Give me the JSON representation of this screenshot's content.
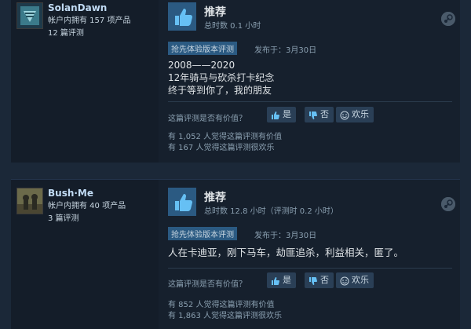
{
  "reviews": [
    {
      "username": "SolanDawn",
      "products_owned": "帐户内拥有 157 项产品",
      "reviews_count": "12 篇评测",
      "recommendation": "推荐",
      "hours": "总时数 0.1 小时",
      "early_access_badge": "抢先体验版本评测",
      "posted": "发布于：3月30日",
      "text_lines": [
        "2008——2020",
        "12年骑马与砍杀打卡纪念",
        "终于等到你了，我的朋友"
      ],
      "helpful_question": "这篇评测是否有价值？",
      "vote_yes": "是",
      "vote_no": "否",
      "vote_funny": "欢乐",
      "helpful_count": "有 1,052 人觉得这篇评测有价值",
      "funny_count": "有 167 人觉得这篇评测很欢乐"
    },
    {
      "username": "Bush·Me",
      "products_owned": "帐户内拥有 40 项产品",
      "reviews_count": "3 篇评测",
      "recommendation": "推荐",
      "hours": "总时数 12.8 小时（评测时 0.2 小时）",
      "early_access_badge": "抢先体验版本评测",
      "posted": "发布于：3月30日",
      "text_lines": [
        "人在卡迪亚，刚下马车，劫匪追杀，利益相关，匿了。"
      ],
      "helpful_question": "这篇评测是否有价值？",
      "vote_yes": "是",
      "vote_no": "否",
      "vote_funny": "欢乐",
      "helpful_count": "有 852 人觉得这篇评测有价值",
      "funny_count": "有 1,863 人觉得这篇评测很欢乐"
    }
  ],
  "colors": {
    "background": "#1b2838",
    "panel": "#16202d",
    "accent": "#2b5a82",
    "username": "#c1dbf4"
  }
}
